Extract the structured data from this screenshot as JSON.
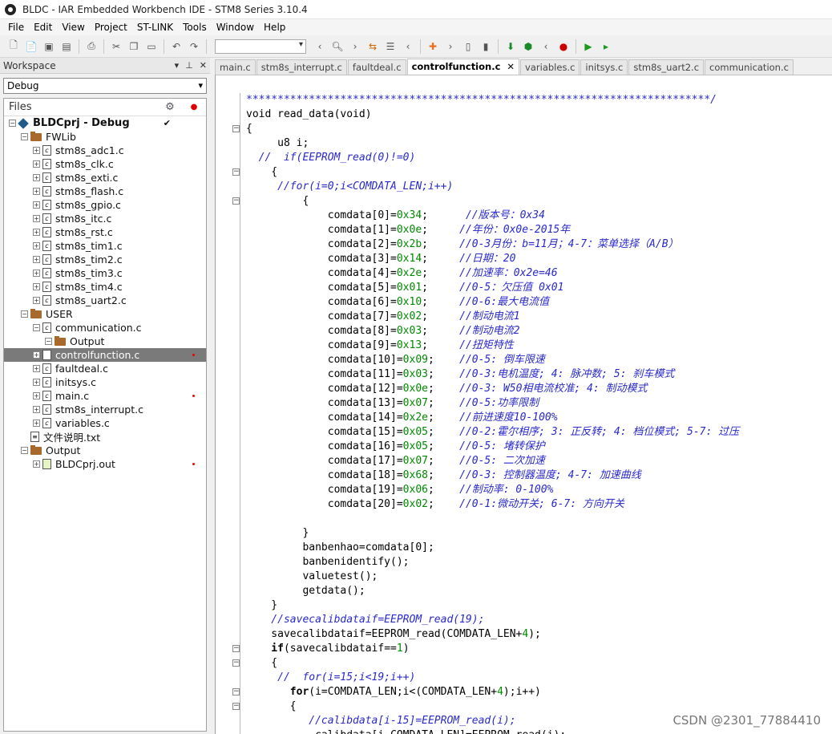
{
  "window": {
    "title": "BLDC - IAR Embedded Workbench IDE - STM8 Series 3.10.4"
  },
  "menu": [
    "File",
    "Edit",
    "View",
    "Project",
    "ST-LINK",
    "Tools",
    "Window",
    "Help"
  ],
  "workspace": {
    "label": "Workspace",
    "pin": "▾",
    "close": "✕",
    "config": "Debug",
    "files_header": "Files"
  },
  "tree": [
    {
      "label": "BLDCprj - Debug",
      "depth": 0,
      "kind": "project",
      "check": "✔",
      "bold": true
    },
    {
      "label": "FWLib",
      "depth": 1,
      "kind": "folder"
    },
    {
      "label": "stm8s_adc1.c",
      "depth": 2,
      "kind": "file"
    },
    {
      "label": "stm8s_clk.c",
      "depth": 2,
      "kind": "file"
    },
    {
      "label": "stm8s_exti.c",
      "depth": 2,
      "kind": "file"
    },
    {
      "label": "stm8s_flash.c",
      "depth": 2,
      "kind": "file"
    },
    {
      "label": "stm8s_gpio.c",
      "depth": 2,
      "kind": "file"
    },
    {
      "label": "stm8s_itc.c",
      "depth": 2,
      "kind": "file"
    },
    {
      "label": "stm8s_rst.c",
      "depth": 2,
      "kind": "file"
    },
    {
      "label": "stm8s_tim1.c",
      "depth": 2,
      "kind": "file"
    },
    {
      "label": "stm8s_tim2.c",
      "depth": 2,
      "kind": "file"
    },
    {
      "label": "stm8s_tim3.c",
      "depth": 2,
      "kind": "file"
    },
    {
      "label": "stm8s_tim4.c",
      "depth": 2,
      "kind": "file"
    },
    {
      "label": "stm8s_uart2.c",
      "depth": 2,
      "kind": "file"
    },
    {
      "label": "USER",
      "depth": 1,
      "kind": "folder"
    },
    {
      "label": "communication.c",
      "depth": 2,
      "kind": "file",
      "open": true
    },
    {
      "label": "Output",
      "depth": 3,
      "kind": "folder"
    },
    {
      "label": "controlfunction.c",
      "depth": 2,
      "kind": "file",
      "selected": true,
      "dot": true
    },
    {
      "label": "faultdeal.c",
      "depth": 2,
      "kind": "file"
    },
    {
      "label": "initsys.c",
      "depth": 2,
      "kind": "file"
    },
    {
      "label": "main.c",
      "depth": 2,
      "kind": "file",
      "dot": true
    },
    {
      "label": "stm8s_interrupt.c",
      "depth": 2,
      "kind": "file"
    },
    {
      "label": "variables.c",
      "depth": 2,
      "kind": "file"
    },
    {
      "label": "文件说明.txt",
      "depth": 1,
      "kind": "doc"
    },
    {
      "label": "Output",
      "depth": 1,
      "kind": "folder",
      "open": true
    },
    {
      "label": "BLDCprj.out",
      "depth": 2,
      "kind": "out",
      "dot": true
    }
  ],
  "tabs": [
    {
      "label": "main.c"
    },
    {
      "label": "stm8s_interrupt.c"
    },
    {
      "label": "faultdeal.c"
    },
    {
      "label": "controlfunction.c",
      "active": true
    },
    {
      "label": "variables.c"
    },
    {
      "label": "initsys.c"
    },
    {
      "label": "stm8s_uart2.c"
    },
    {
      "label": "communication.c"
    }
  ],
  "code": [
    [
      [
        "cm",
        "**************************************************************************/"
      ]
    ],
    [
      [
        "",
        "void read_data(void)"
      ]
    ],
    [
      [
        "",
        "{"
      ]
    ],
    [
      [
        "",
        "     u8 i;"
      ]
    ],
    [
      [
        "cm",
        "  //  if(EEPROM_read(0)!=0)"
      ]
    ],
    [
      [
        "",
        "    {"
      ]
    ],
    [
      [
        "cm",
        "     //for(i=0;i<COMDATA_LEN;i++)"
      ]
    ],
    [
      [
        "",
        "         {"
      ]
    ],
    [
      [
        "",
        "             comdata[0]="
      ],
      [
        "num",
        "0x34"
      ],
      [
        "",
        ";      "
      ],
      [
        "cm",
        "//版本号：0x34"
      ]
    ],
    [
      [
        "",
        "             comdata[1]="
      ],
      [
        "num",
        "0x0e"
      ],
      [
        "",
        ";     "
      ],
      [
        "cm",
        "//年份：0x0e-2015年"
      ]
    ],
    [
      [
        "",
        "             comdata[2]="
      ],
      [
        "num",
        "0x2b"
      ],
      [
        "",
        ";     "
      ],
      [
        "cm",
        "//0-3月份：b=11月；4-7：菜单选择（A/B）"
      ]
    ],
    [
      [
        "",
        "             comdata[3]="
      ],
      [
        "num",
        "0x14"
      ],
      [
        "",
        ";     "
      ],
      [
        "cm",
        "//日期：20"
      ]
    ],
    [
      [
        "",
        "             comdata[4]="
      ],
      [
        "num",
        "0x2e"
      ],
      [
        "",
        ";     "
      ],
      [
        "cm",
        "//加速率：0x2e=46"
      ]
    ],
    [
      [
        "",
        "             comdata[5]="
      ],
      [
        "num",
        "0x01"
      ],
      [
        "",
        ";     "
      ],
      [
        "cm",
        "//0-5：欠压值 0x01"
      ]
    ],
    [
      [
        "",
        "             comdata[6]="
      ],
      [
        "num",
        "0x10"
      ],
      [
        "",
        ";     "
      ],
      [
        "cm",
        "//0-6:最大电流值"
      ]
    ],
    [
      [
        "",
        "             comdata[7]="
      ],
      [
        "num",
        "0x02"
      ],
      [
        "",
        ";     "
      ],
      [
        "cm",
        "//制动电流1"
      ]
    ],
    [
      [
        "",
        "             comdata[8]="
      ],
      [
        "num",
        "0x03"
      ],
      [
        "",
        ";     "
      ],
      [
        "cm",
        "//制动电流2"
      ]
    ],
    [
      [
        "",
        "             comdata[9]="
      ],
      [
        "num",
        "0x13"
      ],
      [
        "",
        ";     "
      ],
      [
        "cm",
        "//扭矩特性"
      ]
    ],
    [
      [
        "",
        "             comdata[10]="
      ],
      [
        "num",
        "0x09"
      ],
      [
        "",
        ";    "
      ],
      [
        "cm",
        "//0-5: 倒车限速"
      ]
    ],
    [
      [
        "",
        "             comdata[11]="
      ],
      [
        "num",
        "0x03"
      ],
      [
        "",
        ";    "
      ],
      [
        "cm",
        "//0-3:电机温度; 4: 脉冲数; 5: 刹车模式"
      ]
    ],
    [
      [
        "",
        "             comdata[12]="
      ],
      [
        "num",
        "0x0e"
      ],
      [
        "",
        ";    "
      ],
      [
        "cm",
        "//0-3: W50相电流校准; 4: 制动模式"
      ]
    ],
    [
      [
        "",
        "             comdata[13]="
      ],
      [
        "num",
        "0x07"
      ],
      [
        "",
        ";    "
      ],
      [
        "cm",
        "//0-5:功率限制"
      ]
    ],
    [
      [
        "",
        "             comdata[14]="
      ],
      [
        "num",
        "0x2e"
      ],
      [
        "",
        ";    "
      ],
      [
        "cm",
        "//前进速度10-100%"
      ]
    ],
    [
      [
        "",
        "             comdata[15]="
      ],
      [
        "num",
        "0x05"
      ],
      [
        "",
        ";    "
      ],
      [
        "cm",
        "//0-2:霍尔相序; 3: 正反转; 4: 档位模式; 5-7: 过压"
      ]
    ],
    [
      [
        "",
        "             comdata[16]="
      ],
      [
        "num",
        "0x05"
      ],
      [
        "",
        ";    "
      ],
      [
        "cm",
        "//0-5: 堵转保护"
      ]
    ],
    [
      [
        "",
        "             comdata[17]="
      ],
      [
        "num",
        "0x07"
      ],
      [
        "",
        ";    "
      ],
      [
        "cm",
        "//0-5: 二次加速"
      ]
    ],
    [
      [
        "",
        "             comdata[18]="
      ],
      [
        "num",
        "0x68"
      ],
      [
        "",
        ";    "
      ],
      [
        "cm",
        "//0-3: 控制器温度; 4-7: 加速曲线"
      ]
    ],
    [
      [
        "",
        "             comdata[19]="
      ],
      [
        "num",
        "0x06"
      ],
      [
        "",
        ";    "
      ],
      [
        "cm",
        "//制动率: 0-100%"
      ]
    ],
    [
      [
        "",
        "             comdata[20]="
      ],
      [
        "num",
        "0x02"
      ],
      [
        "",
        ";    "
      ],
      [
        "cm",
        "//0-1:微动开关; 6-7: 方向开关"
      ]
    ],
    [
      [
        "",
        ""
      ]
    ],
    [
      [
        "",
        "         }"
      ]
    ],
    [
      [
        "",
        "         banbenhao=comdata[0];"
      ]
    ],
    [
      [
        "",
        "         banbenidentify();"
      ]
    ],
    [
      [
        "",
        "         valuetest();"
      ]
    ],
    [
      [
        "",
        "         getdata();"
      ]
    ],
    [
      [
        "",
        "    }"
      ]
    ],
    [
      [
        "cm",
        "    //savecalibdataif=EEPROM_read(19);"
      ]
    ],
    [
      [
        "",
        "    savecalibdataif=EEPROM_read(COMDATA_LEN+"
      ],
      [
        "num",
        "4"
      ],
      [
        "",
        ");"
      ]
    ],
    [
      [
        "kw",
        "    if"
      ],
      [
        "",
        "(savecalibdataif=="
      ],
      [
        "num",
        "1"
      ],
      [
        "",
        ")"
      ]
    ],
    [
      [
        "",
        "    {"
      ]
    ],
    [
      [
        "cm",
        "     //  for(i=15;i<19;i++)"
      ]
    ],
    [
      [
        "",
        "       "
      ],
      [
        "kw",
        "for"
      ],
      [
        "",
        "(i=COMDATA_LEN;i<(COMDATA_LEN+"
      ],
      [
        "num",
        "4"
      ],
      [
        "",
        ");i++)"
      ]
    ],
    [
      [
        "",
        "       {"
      ]
    ],
    [
      [
        "cm",
        "          //calibdata[i-15]=EEPROM_read(i);"
      ]
    ],
    [
      [
        "",
        "           calibdata[i-COMDATA_LEN]=EEPROM_read(i);"
      ]
    ]
  ],
  "folds": [
    2,
    5,
    7,
    38,
    39,
    41,
    42
  ],
  "watermark": "CSDN @2301_77884410"
}
